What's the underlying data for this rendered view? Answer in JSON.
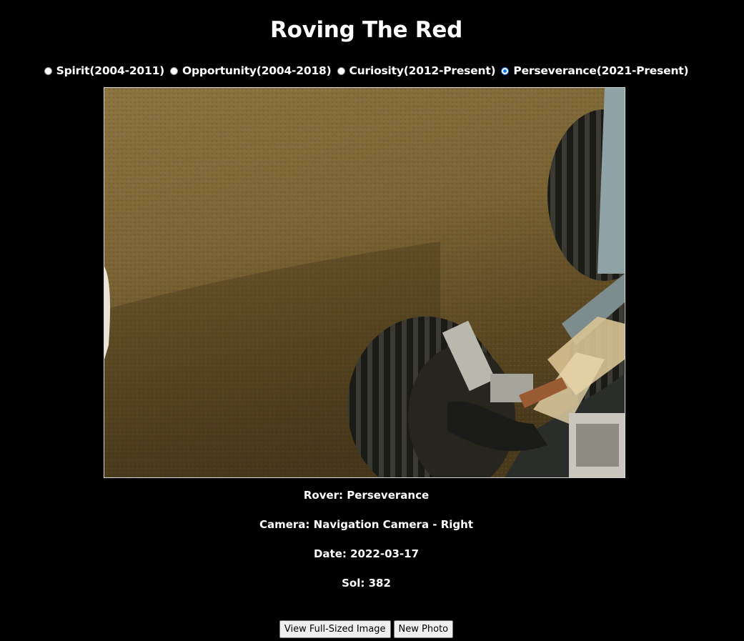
{
  "title": "Roving The Red",
  "rovers": [
    {
      "label": "Spirit(2004-2011)",
      "checked": false
    },
    {
      "label": "Opportunity(2004-2018)",
      "checked": false
    },
    {
      "label": "Curiosity(2012-Present)",
      "checked": false
    },
    {
      "label": "Perseverance(2021-Present)",
      "checked": true
    }
  ],
  "photo": {
    "rover": "Rover: Perseverance",
    "camera": "Camera: Navigation Camera - Right",
    "date": "Date: 2022-03-17",
    "sol": "Sol: 382"
  },
  "buttons": {
    "view_full": "View Full-Sized Image",
    "new_photo": "New Photo"
  },
  "colors": {
    "background": "#000000",
    "text": "#ffffff",
    "radio_accent": "#1a73e8"
  }
}
